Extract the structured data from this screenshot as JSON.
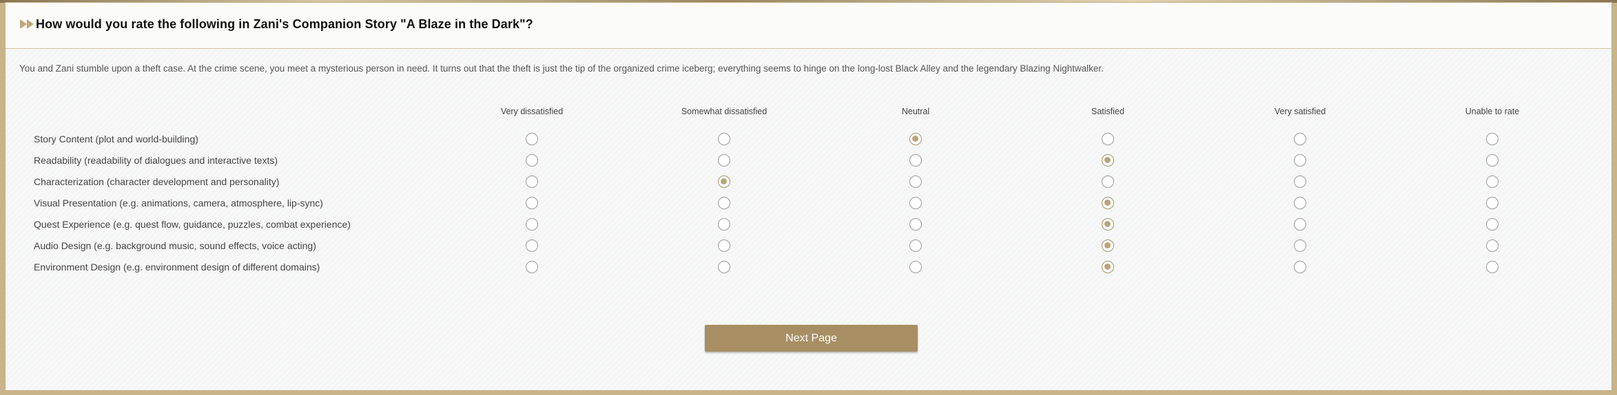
{
  "question": {
    "title": "How would you rate the following in Zani's Companion Story \"A Blaze in the Dark\"?",
    "description": "You and Zani stumble upon a theft case. At the crime scene, you meet a mysterious person in need. It turns out that the theft is just the tip of the organized crime iceberg; everything seems to hinge on the long-lost Black Alley and the legendary Blazing Nightwalker."
  },
  "columns": [
    "Very dissatisfied",
    "Somewhat dissatisfied",
    "Neutral",
    "Satisfied",
    "Very satisfied",
    "Unable to rate"
  ],
  "rows": [
    {
      "label": "Story Content (plot and world-building)",
      "selected": "Neutral"
    },
    {
      "label": "Readability (readability of dialogues and interactive texts)",
      "selected": "Satisfied"
    },
    {
      "label": "Characterization (character development and personality)",
      "selected": "Somewhat dissatisfied"
    },
    {
      "label": "Visual Presentation (e.g. animations, camera, atmosphere, lip-sync)",
      "selected": "Satisfied"
    },
    {
      "label": "Quest Experience (e.g. quest flow, guidance, puzzles, combat experience)",
      "selected": "Satisfied"
    },
    {
      "label": "Audio Design (e.g. background music, sound effects, voice acting)",
      "selected": "Satisfied"
    },
    {
      "label": "Environment Design (e.g. environment design of different domains)",
      "selected": "Satisfied"
    }
  ],
  "next_button": {
    "label": "Next Page"
  },
  "colors": {
    "accent": "#a88e63",
    "radio_selected": "#b9a57b",
    "border": "#c2ad86"
  },
  "icons": {
    "header_marker": "double-arrow-icon"
  }
}
